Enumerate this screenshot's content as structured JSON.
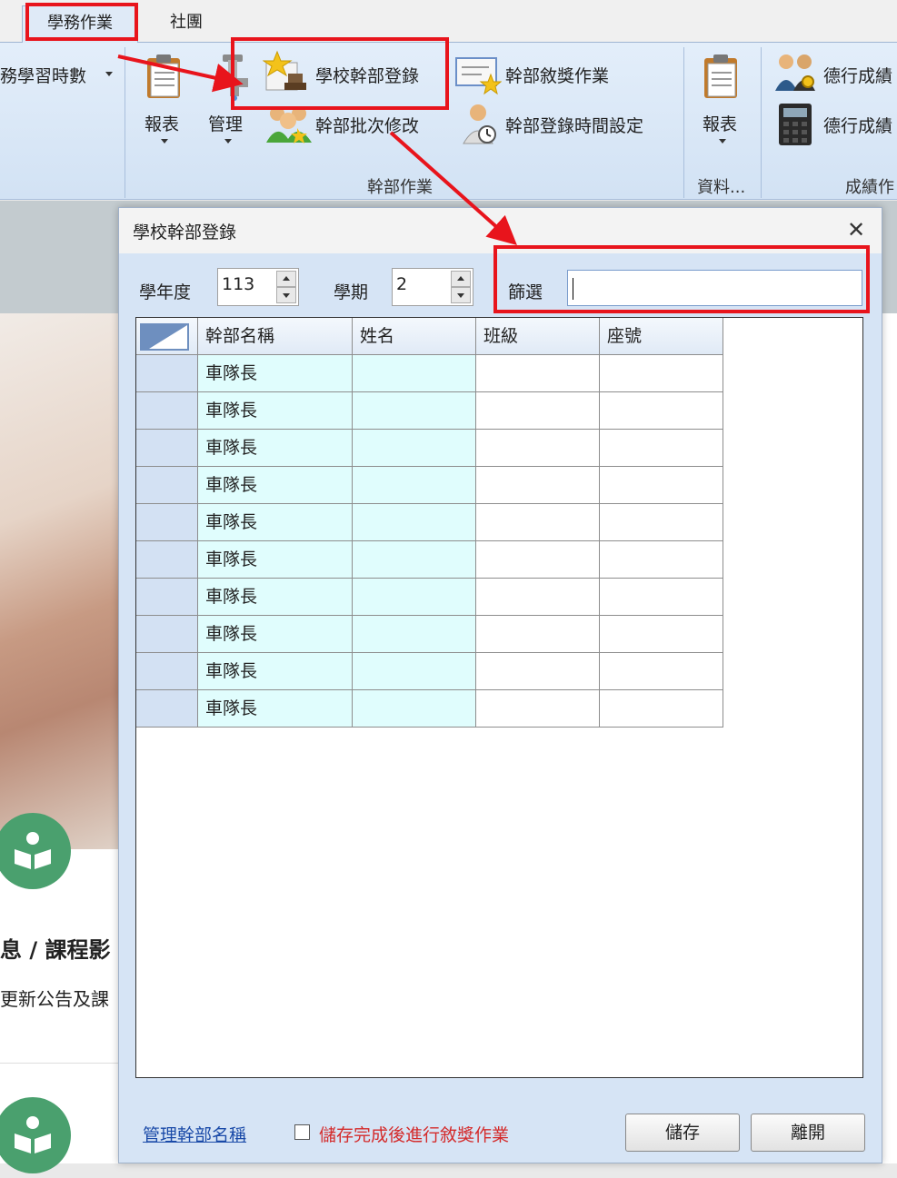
{
  "tabs": [
    {
      "label": "學務作業"
    },
    {
      "label": "社團"
    }
  ],
  "ribbon": {
    "left_cut_item": "務學習時數",
    "group_cadre": {
      "report": "報表",
      "manage": "管理",
      "school_cadre_register": "學校幹部登錄",
      "cadre_batch_edit": "幹部批次修改",
      "cadre_award": "幹部敘獎作業",
      "cadre_register_time": "幹部登錄時間設定",
      "label": "幹部作業"
    },
    "group_data": {
      "report": "報表",
      "label": "資料..."
    },
    "group_grade": {
      "item1": "德行成績",
      "item2": "德行成績",
      "label": "成績作"
    }
  },
  "background": {
    "heading": "息 / 課程影",
    "subtext": "更新公告及課"
  },
  "dialog": {
    "title": "學校幹部登錄",
    "close_icon": "close-icon",
    "year_label": "學年度",
    "year_value": "113",
    "semester_label": "學期",
    "semester_value": "2",
    "filter_label": "篩選",
    "filter_value": "",
    "grid": {
      "columns": [
        "幹部名稱",
        "姓名",
        "班級",
        "座號"
      ],
      "rows": [
        [
          "車隊長",
          "",
          "",
          ""
        ],
        [
          "車隊長",
          "",
          "",
          ""
        ],
        [
          "車隊長",
          "",
          "",
          ""
        ],
        [
          "車隊長",
          "",
          "",
          ""
        ],
        [
          "車隊長",
          "",
          "",
          ""
        ],
        [
          "車隊長",
          "",
          "",
          ""
        ],
        [
          "車隊長",
          "",
          "",
          ""
        ],
        [
          "車隊長",
          "",
          "",
          ""
        ],
        [
          "車隊長",
          "",
          "",
          ""
        ],
        [
          "車隊長",
          "",
          "",
          ""
        ]
      ]
    },
    "manage_link": "管理幹部名稱",
    "checkbox_label": "儲存完成後進行敘獎作業",
    "save_button": "儲存",
    "exit_button": "離開"
  },
  "colors": {
    "annotation_red": "#e8141c",
    "ribbon_blue": "#d2e2f4",
    "cyan_cell": "#e0fdfd",
    "link_blue": "#1a4aa8",
    "warning_red": "#d42a2a"
  }
}
